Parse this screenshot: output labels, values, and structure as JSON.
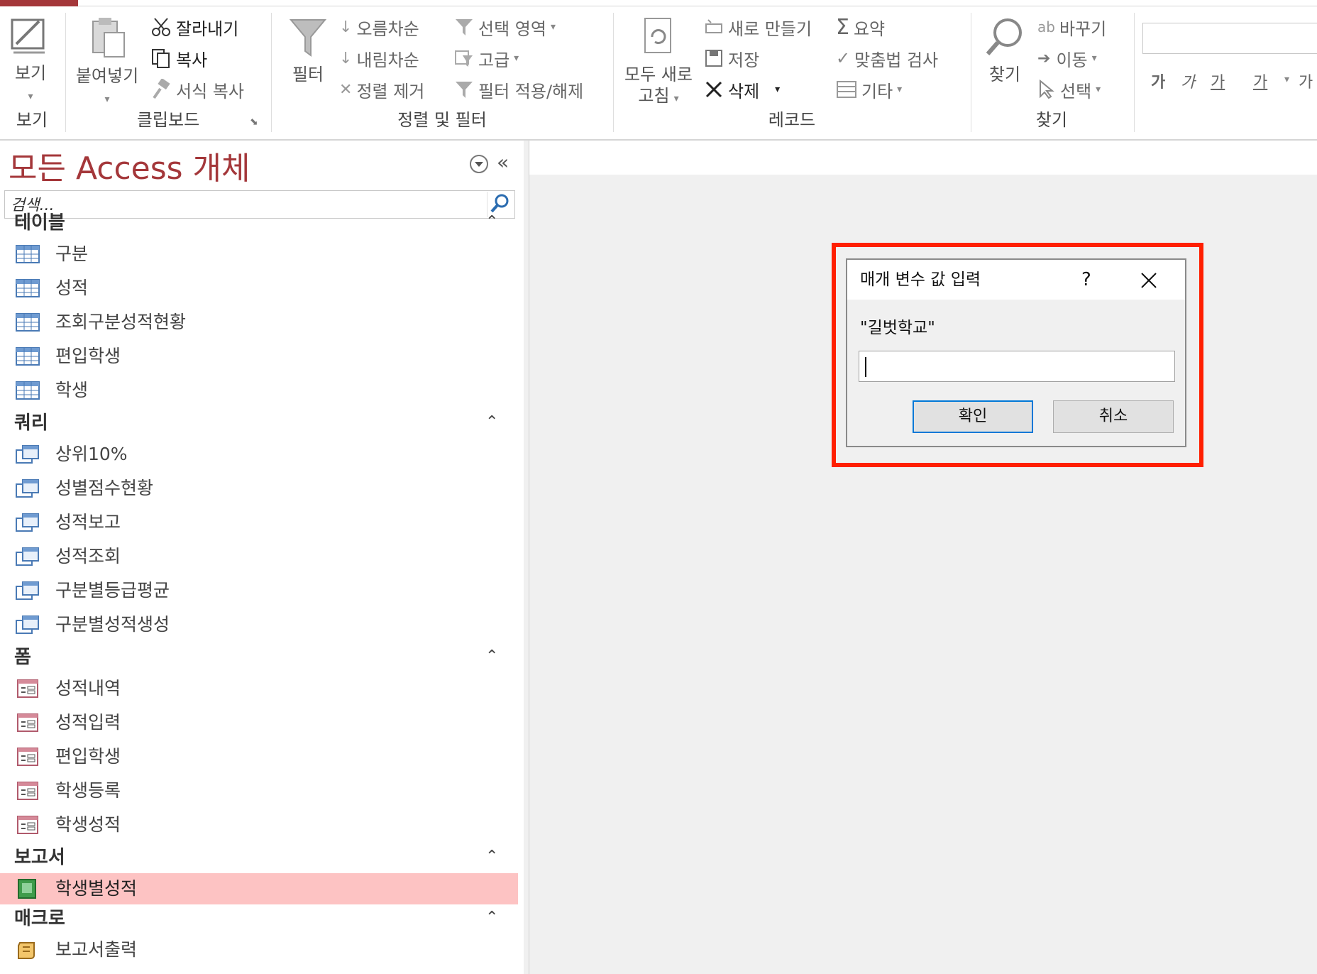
{
  "ribbon": {
    "view": {
      "label": "보기",
      "group_label": "보기"
    },
    "clipboard": {
      "group_label": "클립보드",
      "paste": "붙여넣기",
      "cut": "잘라내기",
      "copy": "복사",
      "format_painter": "서식 복사"
    },
    "sort_filter": {
      "group_label": "정렬 및 필터",
      "filter": "필터",
      "ascending": "오름차순",
      "descending": "내림차순",
      "remove_sort": "정렬 제거",
      "selection": "선택 영역",
      "advanced": "고급",
      "toggle_filter": "필터 적용/해제"
    },
    "records": {
      "group_label": "레코드",
      "refresh_all_line1": "모두 새로",
      "refresh_all_line2": "고침",
      "new": "새로 만들기",
      "save": "저장",
      "delete": "삭제",
      "totals": "요약",
      "spelling": "맞춤법 검사",
      "more": "기타"
    },
    "find": {
      "group_label": "찾기",
      "find": "찾기",
      "replace": "바꾸기",
      "goto": "이동",
      "select": "선택"
    },
    "formatting": {
      "bold": "가",
      "italic": "가",
      "underline": "가",
      "font_color": "가",
      "highlight": "가"
    }
  },
  "nav": {
    "title": "모든 Access 개체",
    "search_placeholder": "검색...",
    "groups": [
      {
        "name": "테이블",
        "items": [
          "구분",
          "성적",
          "조회구분성적현황",
          "편입학생",
          "학생"
        ]
      },
      {
        "name": "쿼리",
        "items": [
          "상위10%",
          "성별점수현황",
          "성적보고",
          "성적조회",
          "구분별등급평균",
          "구분별성적생성"
        ]
      },
      {
        "name": "폼",
        "items": [
          "성적내역",
          "성적입력",
          "편입학생",
          "학생등록",
          "학생성적"
        ]
      },
      {
        "name": "보고서",
        "items": [
          "학생별성적"
        ]
      },
      {
        "name": "매크로",
        "items": [
          "보고서출력"
        ]
      }
    ],
    "selected_item": "학생별성적"
  },
  "dialog": {
    "title": "매개 변수 값 입력",
    "help": "?",
    "prompt": "\"길벗학교\"",
    "value": "",
    "ok": "확인",
    "cancel": "취소"
  },
  "colors": {
    "accent": "#a4373a",
    "selected_item_bg": "#fdc3c3",
    "highlight_box": "#ff1f00",
    "default_button_border": "#0078d7"
  }
}
